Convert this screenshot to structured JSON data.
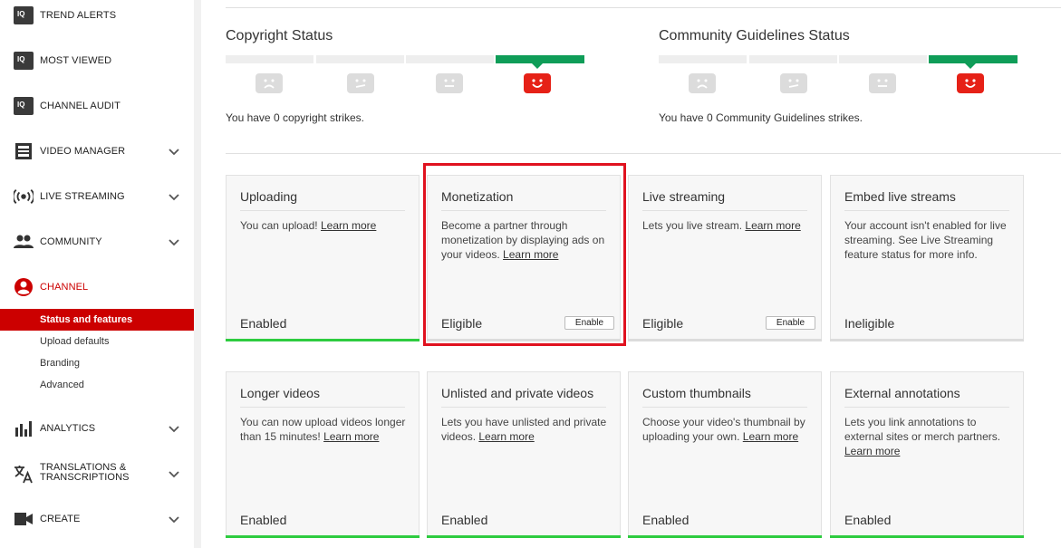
{
  "sidebar": {
    "items": [
      {
        "label": "TREND ALERTS",
        "icon": "iq-logo-icon"
      },
      {
        "label": "MOST VIEWED",
        "icon": "iq-logo-icon"
      },
      {
        "label": "CHANNEL AUDIT",
        "icon": "iq-logo-icon"
      },
      {
        "label": "VIDEO MANAGER",
        "icon": "video-manager-icon"
      },
      {
        "label": "LIVE STREAMING",
        "icon": "live-streaming-icon"
      },
      {
        "label": "COMMUNITY",
        "icon": "community-icon"
      },
      {
        "label": "CHANNEL",
        "icon": "channel-icon"
      },
      {
        "label": "ANALYTICS",
        "icon": "analytics-icon"
      },
      {
        "label": "TRANSLATIONS &",
        "label2": "TRANSCRIPTIONS",
        "icon": "translations-icon"
      },
      {
        "label": "CREATE",
        "icon": "create-icon"
      }
    ],
    "iq_badge": "IQ",
    "channel_subitems": [
      "Status and features",
      "Upload defaults",
      "Branding",
      "Advanced"
    ],
    "active_color": "#cc0000"
  },
  "copyright": {
    "title": "Copyright Status",
    "text": "You have 0 copyright strikes."
  },
  "community": {
    "title": "Community Guidelines Status",
    "text": "You have 0 Community Guidelines strikes."
  },
  "cards": [
    {
      "title": "Uploading",
      "desc": "You can upload!",
      "link": "Learn more",
      "status": "Enabled"
    },
    {
      "title": "Monetization",
      "desc": "Become a partner through monetization by displaying ads on your videos.",
      "link": "Learn more",
      "status": "Eligible",
      "button": "Enable"
    },
    {
      "title": "Live streaming",
      "desc": "Lets you live stream.",
      "link": "Learn more",
      "status": "Eligible",
      "button": "Enable"
    },
    {
      "title": "Embed live streams",
      "desc": "Your account isn't enabled for live streaming. See Live Streaming feature status for more info.",
      "link": "",
      "status": "Ineligible"
    },
    {
      "title": "Longer videos",
      "desc": "You can now upload videos longer than 15 minutes!",
      "link": "Learn more",
      "status": "Enabled"
    },
    {
      "title": "Unlisted and private videos",
      "desc": "Lets you have unlisted and private videos.",
      "link": "Learn more",
      "status": "Enabled"
    },
    {
      "title": "Custom thumbnails",
      "desc": "Choose your video's thumbnail by uploading your own.",
      "link": "Learn more",
      "status": "Enabled"
    },
    {
      "title": "External annotations",
      "desc": "Lets you link annotations to external sites or merch partners.",
      "link": "Learn more",
      "status": "Enabled"
    }
  ],
  "colors": {
    "green": "#2ecc40",
    "strike_green": "#0f9d58",
    "red": "#e62117",
    "highlight": "#e0121f"
  }
}
